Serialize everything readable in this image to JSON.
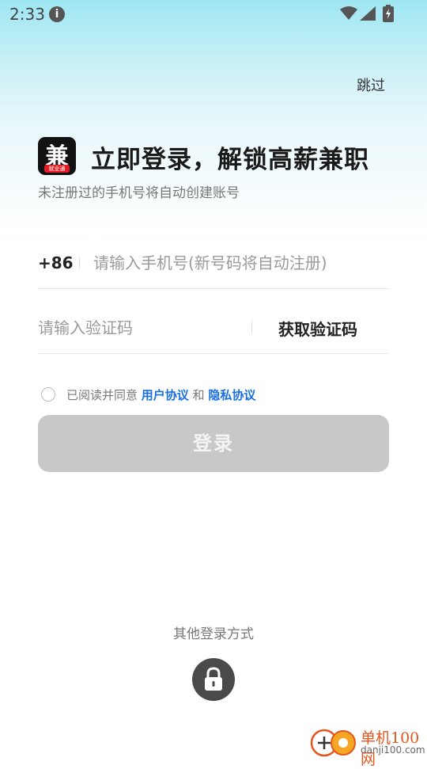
{
  "status_bar": {
    "time": "2:33",
    "info_icon": "info-icon",
    "wifi_icon": "wifi-icon",
    "signal_icon": "signal-icon",
    "battery_icon": "battery-icon"
  },
  "header": {
    "skip_label": "跳过"
  },
  "brand": {
    "logo_glyph": "兼",
    "logo_tag": "就业通"
  },
  "hero": {
    "title": "立即登录，解锁高薪兼职",
    "subtitle": "未注册过的手机号将自动创建账号"
  },
  "form": {
    "country_code": "+86",
    "phone_value": "",
    "phone_placeholder": "请输入手机号(新号码将自动注册)",
    "code_value": "",
    "code_placeholder": "请输入验证码",
    "get_code_label": "获取验证码"
  },
  "agreement": {
    "checked": false,
    "prefix": "已阅读并同意 ",
    "user_agreement": "用户协议",
    "and": " 和 ",
    "privacy_policy": "隐私协议"
  },
  "login_button": {
    "label": "登录",
    "enabled": false
  },
  "other_login": {
    "label": "其他登录方式",
    "icon": "lock-icon"
  },
  "watermark": {
    "cn": "单机100网",
    "url": "danji100.com"
  },
  "colors": {
    "accent_link": "#1a6fe0",
    "button_disabled": "#c8c8c8",
    "watermark": "#e4561e"
  }
}
